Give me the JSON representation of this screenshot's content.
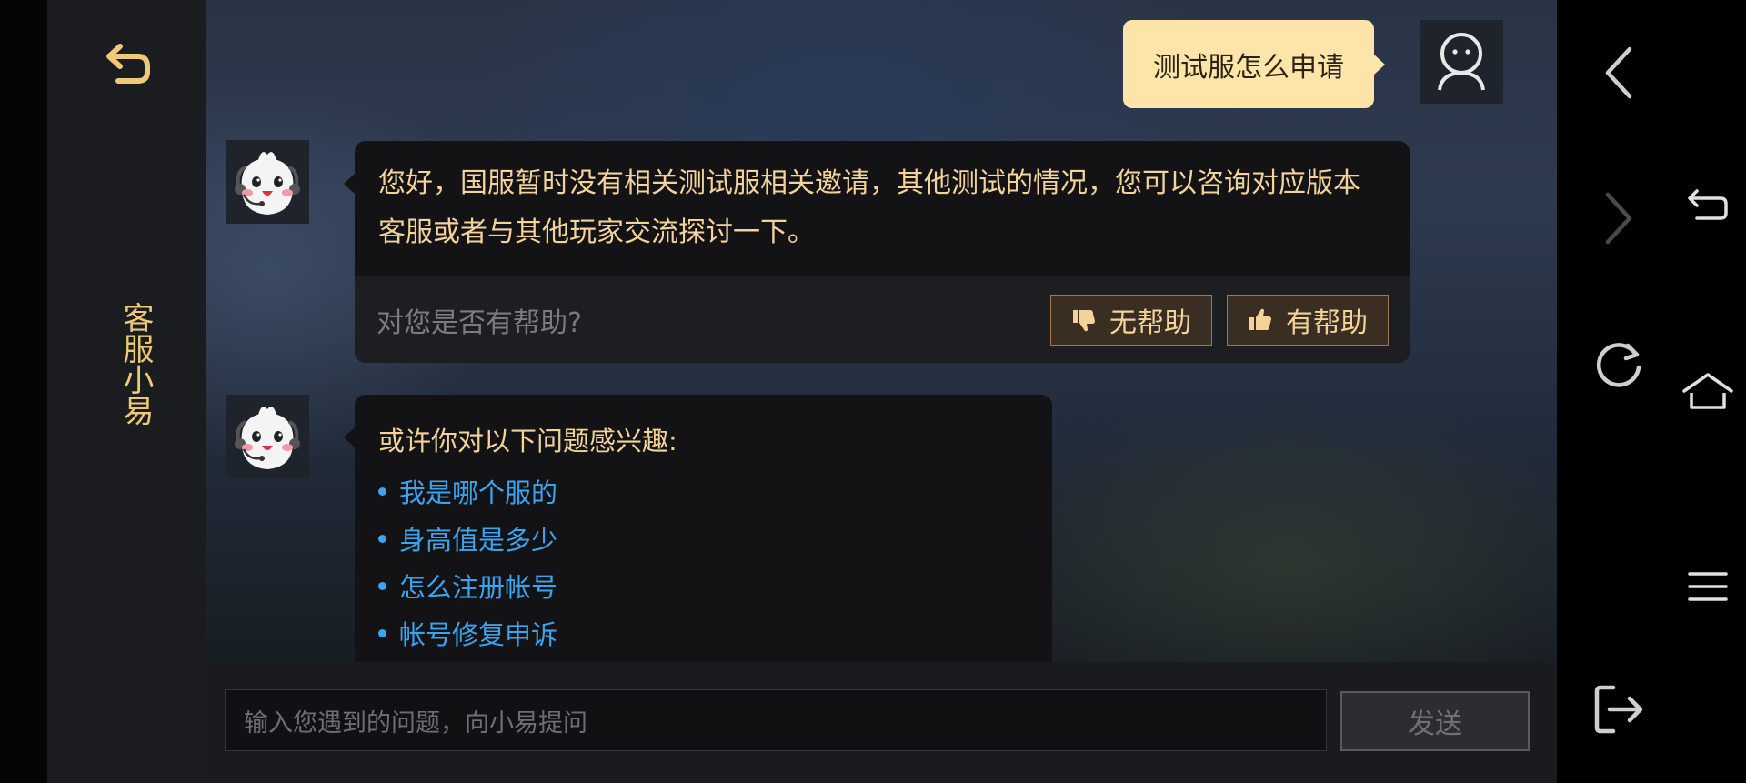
{
  "sidebar": {
    "title": "客服小易",
    "back_icon": "return-arrow-icon"
  },
  "chat": {
    "user_message": "测试服怎么申请",
    "bot_answer": "您好，国服暂时没有相关测试服相关邀请，其他测试的情况，您可以咨询对应版本客服或者与其他玩家交流探讨一下。",
    "feedback_question": "对您是否有帮助?",
    "not_helpful_label": "无帮助",
    "helpful_label": "有帮助",
    "suggest_title": "或许你对以下问题感兴趣:",
    "suggestions": [
      "我是哪个服的",
      "身高值是多少",
      "怎么注册帐号",
      "帐号修复申诉"
    ]
  },
  "input": {
    "placeholder": "输入您遇到的问题，向小易提问",
    "send_label": "发送"
  },
  "colors": {
    "accent_gold": "#f3d39a",
    "user_bubble": "#fde4a8",
    "link_blue": "#3ba4f0"
  },
  "nav_icons": [
    "back-chevron-icon",
    "forward-chevron-icon",
    "return-icon",
    "refresh-icon",
    "home-icon",
    "menu-icon",
    "exit-icon"
  ]
}
